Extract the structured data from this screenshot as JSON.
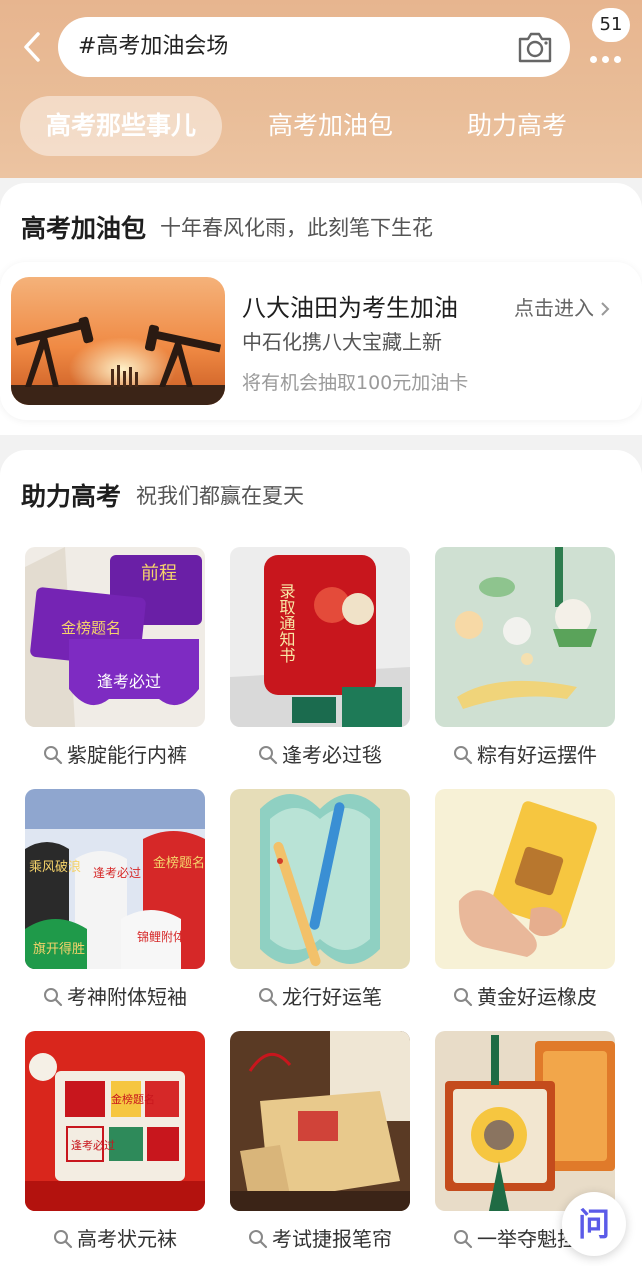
{
  "search": {
    "query": "#高考加油会场"
  },
  "header": {
    "badge_count": "51"
  },
  "tabs": [
    {
      "label": "高考那些事儿",
      "active": true
    },
    {
      "label": "高考加油包",
      "active": false
    },
    {
      "label": "助力高考",
      "active": false
    }
  ],
  "section1": {
    "title": "高考加油包",
    "subtitle": "十年春风化雨，此刻笔下生花",
    "promo": {
      "title": "八大油田为考生加油",
      "link": "点击进入",
      "subtitle": "中石化携八大宝藏上新",
      "note": "将有机会抽取100元加油卡"
    }
  },
  "section2": {
    "title": "助力高考",
    "subtitle": "祝我们都赢在夏天",
    "items": [
      {
        "label": "紫腚能行内裤",
        "thumb_text": [
          "前程",
          "金榜题名",
          "逢考必过"
        ]
      },
      {
        "label": "逢考必过毯",
        "thumb_text": [
          "录取通知书"
        ]
      },
      {
        "label": "粽有好运摆件"
      },
      {
        "label": "考神附体短袖",
        "thumb_text": [
          "乘风破浪",
          "逢考必过",
          "金榜题名",
          "旗开得胜",
          "锦鲤附体"
        ]
      },
      {
        "label": "龙行好运笔"
      },
      {
        "label": "黄金好运橡皮"
      },
      {
        "label": "高考状元袜",
        "thumb_text": [
          "金榜题名",
          "逢考必过"
        ]
      },
      {
        "label": "考试捷报笔帘"
      },
      {
        "label": "一举夺魁挂件"
      }
    ]
  },
  "float_button": {
    "glyph": "问"
  },
  "colors": {
    "header_bg": "#e9bc97",
    "accent_orange": "#e08a3c"
  }
}
